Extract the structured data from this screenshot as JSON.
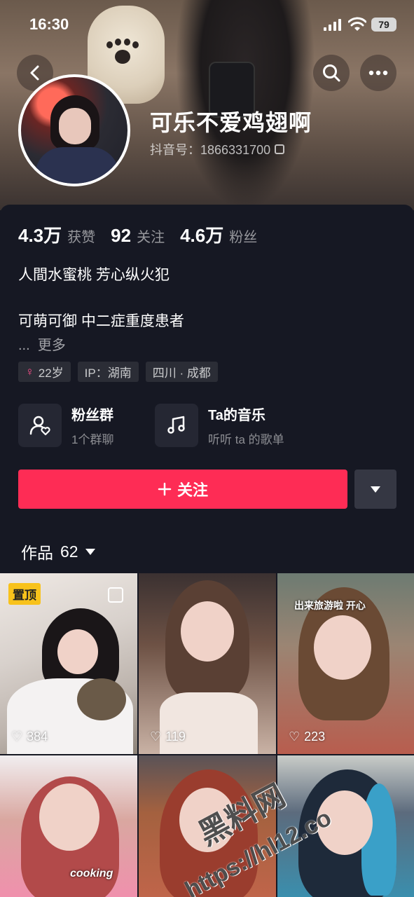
{
  "status_bar": {
    "time": "16:30",
    "battery": "79"
  },
  "profile": {
    "nickname": "可乐不爱鸡翅啊",
    "douyin_id": "抖音号：1866331700"
  },
  "stats": [
    {
      "value": "4.3万",
      "label": "获赞"
    },
    {
      "value": "92",
      "label": "关注"
    },
    {
      "value": "4.6万",
      "label": "粉丝"
    }
  ],
  "bio": {
    "line1": "人間水蜜桃 芳心纵火犯",
    "line2": "可萌可御 中二症重度患者",
    "ellipsis": "...",
    "more": "更多"
  },
  "tags": {
    "age": "22岁",
    "ip": "IP：湖南",
    "location": "四川 · 成都"
  },
  "entries": {
    "fans_title": "粉丝群",
    "fans_sub": "1个群聊",
    "music_title": "Ta的音乐",
    "music_sub": "听听 ta 的歌单"
  },
  "actions": {
    "follow": "关注"
  },
  "works": {
    "label": "作品",
    "count": "62"
  },
  "grid": {
    "pin_label": "置顶",
    "cells": [
      {
        "likes": "384"
      },
      {
        "likes": "119"
      },
      {
        "likes": "223",
        "caption": "出来旅游啦 开心"
      },
      {
        "caption": "cooking"
      },
      {},
      {}
    ]
  },
  "watermark": {
    "line1": "黑料网",
    "line2": "https://hl12.co"
  },
  "colors": {
    "accent": "#fe2c55",
    "background": "#161823",
    "pin": "#f8c21b"
  }
}
